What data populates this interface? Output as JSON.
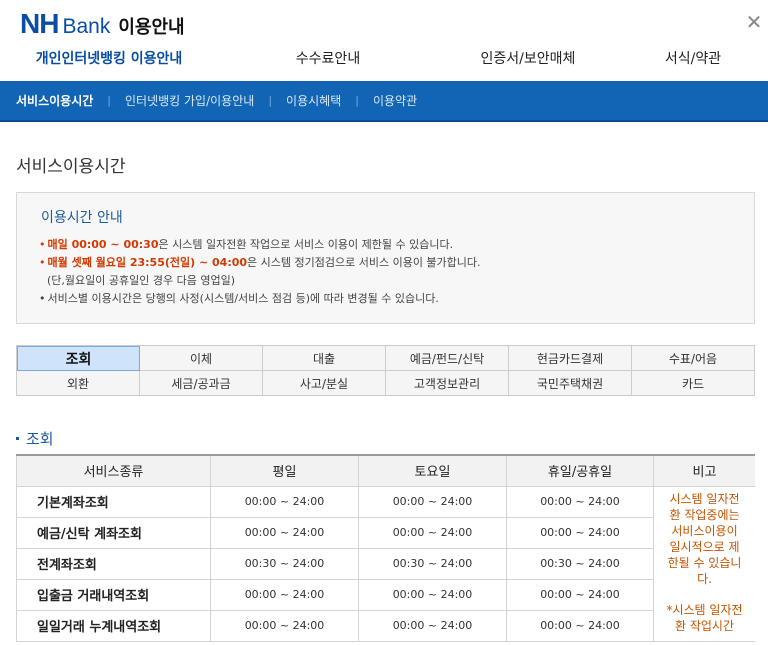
{
  "header": {
    "logo_nh": "NH",
    "logo_bank": "Bank",
    "title": "이용안내",
    "close_icon": "close-icon"
  },
  "main_tabs": [
    {
      "label": "개인인터넷뱅킹 이용안내",
      "active": true
    },
    {
      "label": "수수료안내",
      "active": false
    },
    {
      "label": "인증서/보안매체",
      "active": false
    },
    {
      "label": "서식/약관",
      "active": false
    }
  ],
  "sub_nav": [
    {
      "label": "서비스이용시간",
      "active": true
    },
    {
      "label": "인터넷뱅킹 가입/이용안내",
      "active": false
    },
    {
      "label": "이용시혜택",
      "active": false
    },
    {
      "label": "이용약관",
      "active": false
    }
  ],
  "page_title": "서비스이용시간",
  "notice": {
    "title": "이용시간 안내",
    "line1_hl": "매일 00:00 ~ 00:30",
    "line1_rest": "은 시스템 일자전환 작업으로 서비스 이용이 제한될 수 있습니다.",
    "line2_hl": "매월 셋째 월요일 23:55(전일) ~ 04:00",
    "line2_rest": "은 시스템 정기점검으로 서비스 이용이 불가합니다.",
    "line3": "(단,월요일이 공휴일인 경우 다음 영업일)",
    "line4": "서비스별 이용시간은 당행의 사정(시스템/서비스 점검 등)에 따라 변경될 수 있습니다."
  },
  "service_tabs": [
    {
      "label": "조회",
      "active": true
    },
    {
      "label": "이체",
      "active": false
    },
    {
      "label": "대출",
      "active": false
    },
    {
      "label": "예금/펀드/신탁",
      "active": false
    },
    {
      "label": "현금카드결제",
      "active": false
    },
    {
      "label": "수표/어음",
      "active": false
    },
    {
      "label": "외환",
      "active": false
    },
    {
      "label": "세금/공과금",
      "active": false
    },
    {
      "label": "사고/분실",
      "active": false
    },
    {
      "label": "고객정보관리",
      "active": false
    },
    {
      "label": "국민주택채권",
      "active": false
    },
    {
      "label": "카드",
      "active": false
    }
  ],
  "section_title": "조회",
  "table": {
    "headers": [
      "서비스종류",
      "평일",
      "토요일",
      "휴일/공휴일",
      "비고"
    ],
    "rows": [
      {
        "name": "기본계좌조회",
        "weekday": "00:00 ~ 24:00",
        "saturday": "00:00 ~ 24:00",
        "holiday": "00:00 ~ 24:00"
      },
      {
        "name": "예금/신탁 계좌조회",
        "weekday": "00:00 ~ 24:00",
        "saturday": "00:00 ~ 24:00",
        "holiday": "00:00 ~ 24:00"
      },
      {
        "name": "전계좌조회",
        "weekday": "00:30 ~ 24:00",
        "saturday": "00:30 ~ 24:00",
        "holiday": "00:30 ~ 24:00"
      },
      {
        "name": "입출금 거래내역조회",
        "weekday": "00:00 ~ 24:00",
        "saturday": "00:00 ~ 24:00",
        "holiday": "00:00 ~ 24:00"
      },
      {
        "name": "일일거래 누계내역조회",
        "weekday": "00:00 ~ 24:00",
        "saturday": "00:00 ~ 24:00",
        "holiday": "00:00 ~ 24:00"
      }
    ],
    "note_line1": "시스템 일자전",
    "note_line2": "환 작업중에는",
    "note_line3": "서비스이용이",
    "note_line4": "일시적으로 제",
    "note_line5": "한될 수 있습니",
    "note_line6": "다.",
    "note_line7": "*시스템 일자전",
    "note_line8": "환 작업시간"
  }
}
